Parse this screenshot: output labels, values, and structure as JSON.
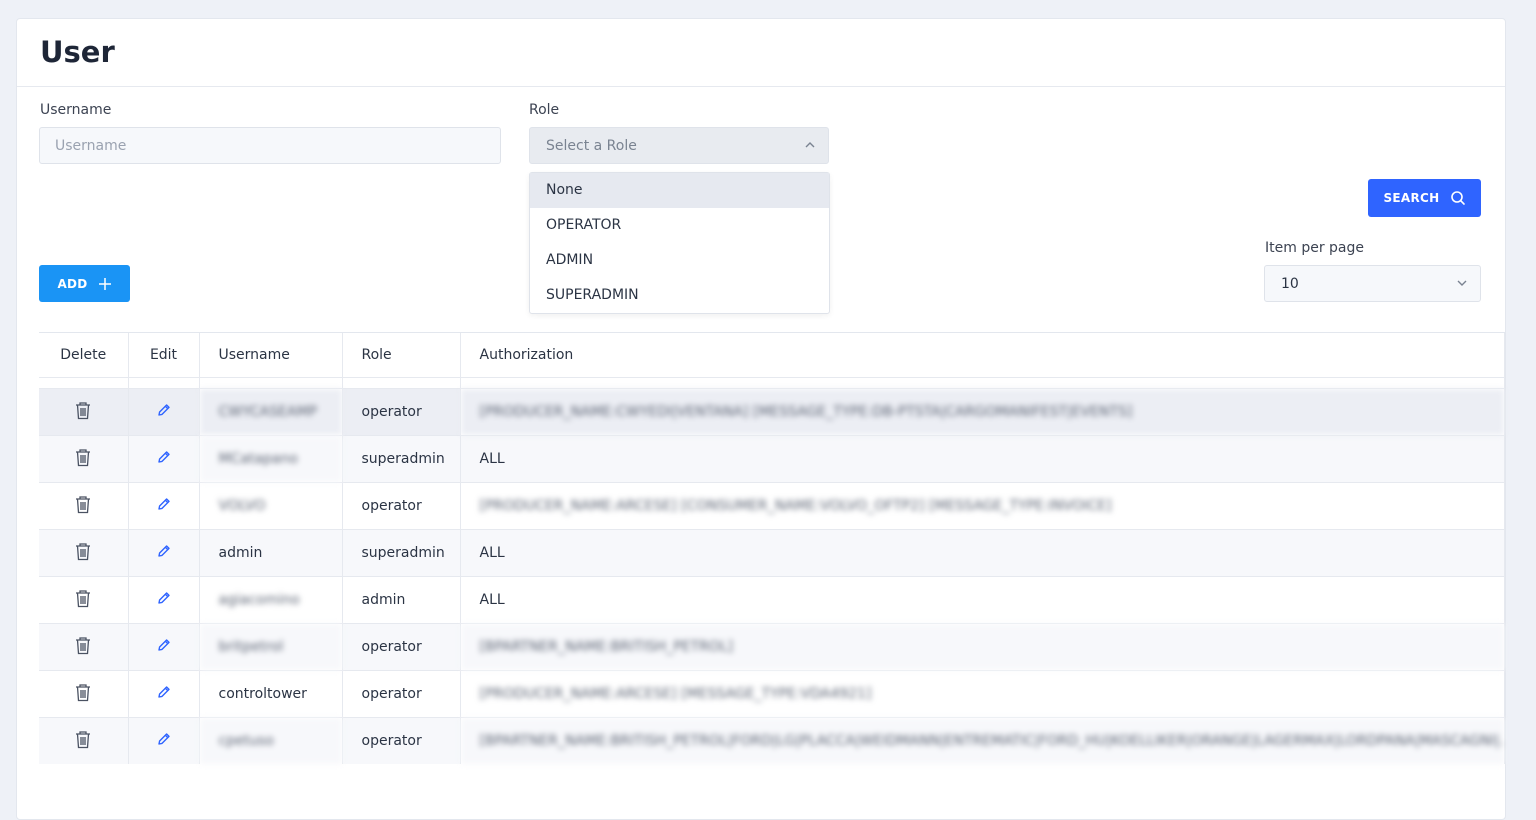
{
  "page": {
    "title": "User"
  },
  "filters": {
    "username_label": "Username",
    "username_placeholder": "Username",
    "username_value": "",
    "role_label": "Role",
    "role_placeholder": "Select a Role",
    "role_options": [
      "None",
      "OPERATOR",
      "ADMIN",
      "SUPERADMIN"
    ],
    "role_highlighted": "None",
    "search_label": "SEARCH",
    "items_per_page_label": "Item per page",
    "items_per_page_value": "10"
  },
  "actions": {
    "add_label": "ADD"
  },
  "table": {
    "columns": [
      "Delete",
      "Edit",
      "Username",
      "Role",
      "Authorization"
    ],
    "rows": [
      {
        "username": "CWYCASEAMP",
        "role": "operator",
        "authorization": "[PRODUCER_NAME:CWYEDI|VENTANA] [MESSAGE_TYPE:DB-PTSTA|CARGOMANIFEST|EVENTS]",
        "blurred": true
      },
      {
        "username": "MCatapano",
        "role": "superadmin",
        "authorization": "ALL",
        "blurred": true,
        "auth_blurred": false
      },
      {
        "username": "VOLVO",
        "role": "operator",
        "authorization": "[PRODUCER_NAME:ARCESE] [CONSUMER_NAME:VOLVO_OFTP2] [MESSAGE_TYPE:INVOICE]",
        "blurred": true
      },
      {
        "username": "admin",
        "role": "superadmin",
        "authorization": "ALL",
        "blurred": false
      },
      {
        "username": "agiacomino",
        "role": "admin",
        "authorization": "ALL",
        "blurred": true,
        "auth_blurred": false
      },
      {
        "username": "britpetrol",
        "role": "operator",
        "authorization": "[BPARTNER_NAME:BRITISH_PETROL]",
        "blurred": true
      },
      {
        "username": "controltower",
        "role": "operator",
        "authorization": "[PRODUCER_NAME:ARCESE] [MESSAGE_TYPE:VDA4921]",
        "blurred": false,
        "auth_blurred": true
      },
      {
        "username": "cpetuso",
        "role": "operator",
        "authorization": "[BPARTNER_NAME:BRITISH_PETROL|FORD|LG|PLACCA|WEIDMANN|ENTREMATIC|FORD_HU|KOELLIKER|ORANGE|LAGERMAX|LORDPANA|MASCAGNI|...]",
        "blurred": true
      }
    ]
  },
  "colors": {
    "primary": "#2f64ff",
    "add": "#1a94f5",
    "background": "#eef1f7"
  },
  "icons": {
    "delete": "trash-icon",
    "edit": "pencil-icon",
    "search": "search-icon",
    "add": "plus-icon",
    "chevron_up": "chevron-up-icon",
    "chevron_down": "chevron-down-icon"
  }
}
